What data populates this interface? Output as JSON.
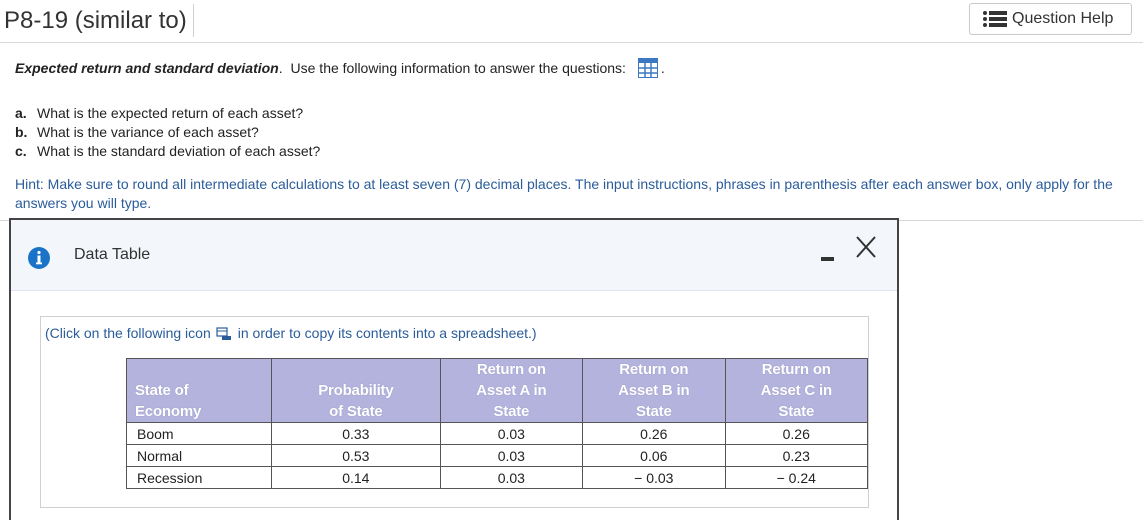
{
  "header": {
    "problem_id": "P8-19 (similar to)",
    "help_button_label": "Question Help",
    "help_icon": "list-icon"
  },
  "intro": {
    "topic": "Expected return and standard deviation",
    "topic_end": ".",
    "instruction": "Use the following information to answer the questions:",
    "trailing": ".",
    "data_icon": "grid-icon"
  },
  "questions": [
    {
      "letter": "a.",
      "text": "What is the expected return of each asset?"
    },
    {
      "letter": "b.",
      "text": "What is the variance of each asset?"
    },
    {
      "letter": "c.",
      "text": "What is the standard deviation of each asset?"
    }
  ],
  "hint": "Hint: Make sure to round all intermediate calculations to at least seven (7) decimal places. The input instructions, phrases in parenthesis after each answer box, only apply for the answers you will type.",
  "popup": {
    "title": "Data Table",
    "info_icon": "info-icon",
    "minimize_icon": "minimize-icon",
    "close_icon": "close-icon",
    "copy_note_before": "(Click on the following icon",
    "copy_note_after": "in order to copy its contents into a spreadsheet.)",
    "copy_icon": "copy-icon",
    "table": {
      "headers": {
        "state": [
          "State of",
          "Economy"
        ],
        "probability": [
          "Probability",
          "of State"
        ],
        "asset_a": [
          "Return on",
          "Asset A in",
          "State"
        ],
        "asset_b": [
          "Return on",
          "Asset B in",
          "State"
        ],
        "asset_c": [
          "Return on",
          "Asset C in",
          "State"
        ]
      },
      "rows": [
        {
          "state": "Boom",
          "probability": "0.33",
          "asset_a": "0.03",
          "asset_b": "0.26",
          "asset_c": "0.26"
        },
        {
          "state": "Normal",
          "probability": "0.53",
          "asset_a": "0.03",
          "asset_b": "0.06",
          "asset_c": "0.23"
        },
        {
          "state": "Recession",
          "probability": "0.14",
          "asset_a": "0.03",
          "asset_b": "− 0.03",
          "asset_c": "− 0.24"
        }
      ]
    }
  },
  "colors": {
    "hint_text": "#2a5c9a",
    "table_header_bg": "#b3b3dd",
    "info_icon": "#1a73c7",
    "popup_header_bg": "#f3f7fb"
  }
}
